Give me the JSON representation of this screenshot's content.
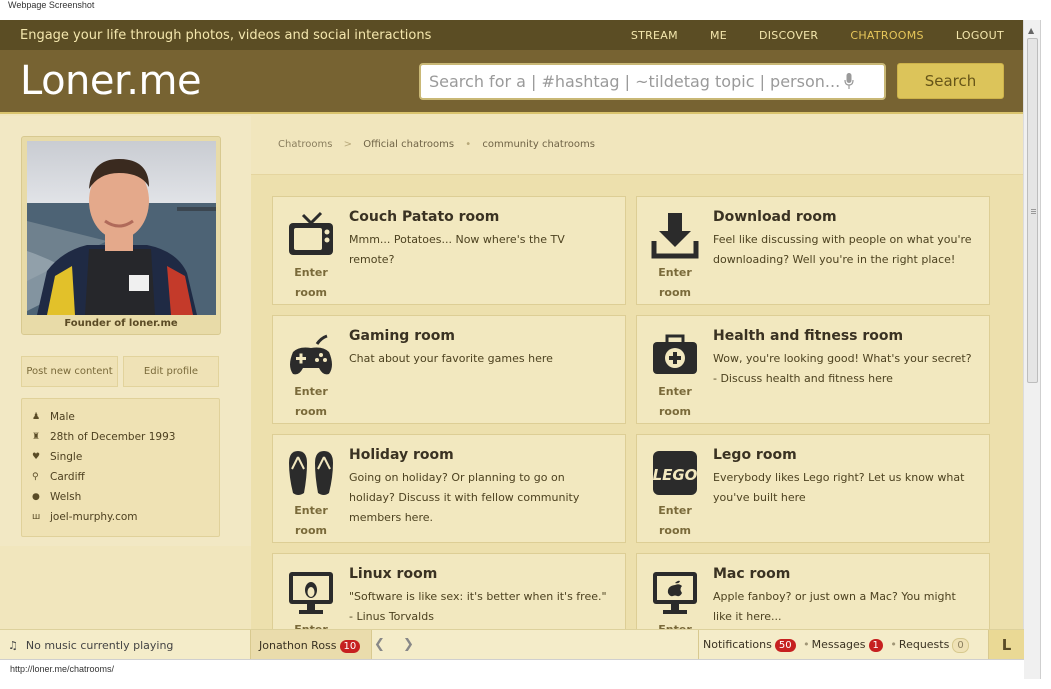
{
  "caption": "Webpage Screenshot",
  "topbar": {
    "tagline": "Engage your life through photos, videos and social interactions",
    "nav": [
      {
        "label": "STREAM"
      },
      {
        "label": "ME"
      },
      {
        "label": "DISCOVER"
      },
      {
        "label": "CHATROOMS",
        "active": true
      },
      {
        "label": "LOGOUT"
      }
    ]
  },
  "header": {
    "logo": "Loner.me",
    "search_placeholder": "Search for a | #hashtag | ~tildetag topic | person...",
    "search_button": "Search"
  },
  "profile": {
    "caption": "Founder of loner.me",
    "post_button": "Post new content",
    "edit_button": "Edit profile",
    "details": [
      {
        "icon": "person-icon",
        "text": "Male"
      },
      {
        "icon": "cake-icon",
        "text": "28th of December 1993"
      },
      {
        "icon": "heart-icon",
        "text": "Single"
      },
      {
        "icon": "pin-icon",
        "text": "Cardiff"
      },
      {
        "icon": "globe-icon",
        "text": "Welsh"
      },
      {
        "icon": "link-icon",
        "text": "joel-murphy.com"
      }
    ]
  },
  "breadcrumb": {
    "root": "Chatrooms",
    "current": "Official chatrooms",
    "other": "community chatrooms"
  },
  "rooms": [
    {
      "icon": "tv-icon",
      "title": "Couch Patato room",
      "desc": "Mmm... Potatoes... Now where's the TV remote?",
      "enter": "Enter room"
    },
    {
      "icon": "download-icon",
      "title": "Download room",
      "desc": "Feel like discussing with people on what you're downloading? Well you're in the right place!",
      "enter": "Enter room"
    },
    {
      "icon": "gamepad-icon",
      "title": "Gaming room",
      "desc": "Chat about your favorite games here",
      "enter": "Enter room"
    },
    {
      "icon": "medkit-icon",
      "title": "Health and fitness room",
      "desc": "Wow, you're looking good! What's your secret? - Discuss health and fitness here",
      "enter": "Enter room"
    },
    {
      "icon": "flipflops-icon",
      "title": "Holiday room",
      "desc": "Going on holiday? Or planning to go on holiday? Discuss it with fellow community members here.",
      "enter": "Enter room"
    },
    {
      "icon": "lego-icon",
      "title": "Lego room",
      "desc": "Everybody likes Lego right? Let us know what you've built here",
      "enter": "Enter room"
    },
    {
      "icon": "linux-icon",
      "title": "Linux room",
      "desc": "\"Software is like sex: it's better when it's free.\" - Linus Torvalds",
      "enter": "Enter room"
    },
    {
      "icon": "apple-icon",
      "title": "Mac room",
      "desc": "Apple fanboy? or just own a Mac? You might like it here...",
      "enter": "Enter room"
    }
  ],
  "lego_text": "LEGO",
  "footer": {
    "music": "No music currently playing",
    "chat_user": "Jonathon Ross",
    "chat_count": "10",
    "notifications_label": "Notifications",
    "notifications_count": "50",
    "messages_label": "Messages",
    "messages_count": "1",
    "requests_label": "Requests",
    "requests_count": "0",
    "l_button": "L"
  },
  "status_url": "http://loner.me/chatrooms/",
  "colors": {
    "accent": "#dcc45a",
    "header": "#776332",
    "topbar": "#5b4d24",
    "badge": "#c62020"
  }
}
